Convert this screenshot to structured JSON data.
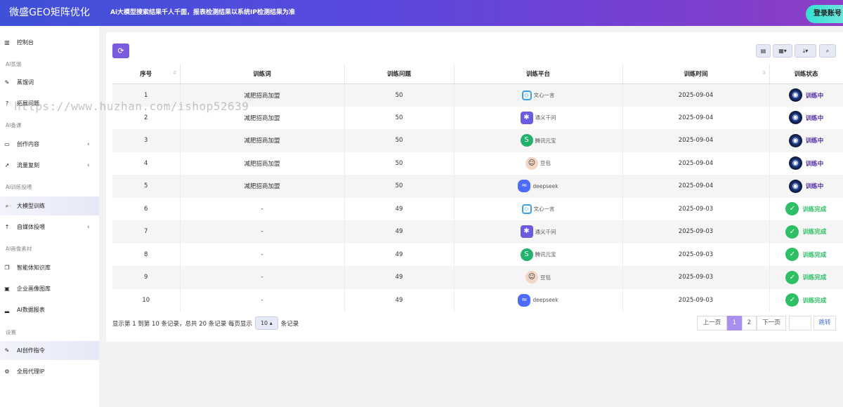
{
  "header": {
    "brand": "微盛GEO矩阵优化",
    "notice": "Ai大模型搜索结果千人千面，报表检测结果以系统IP检测结果为准",
    "login": "登录账号"
  },
  "sidebar": {
    "items": [
      {
        "label": "控制台",
        "icon": "chart-icon"
      },
      {
        "section": "AI蒸馏"
      },
      {
        "label": "蒸馏词",
        "icon": "tag-icon"
      },
      {
        "label": "拓展问题",
        "icon": "question-icon"
      },
      {
        "section": "AI备课"
      },
      {
        "label": "创作内容",
        "icon": "folder-icon",
        "arrow": "‹"
      },
      {
        "label": "流量复刻",
        "icon": "rocket-icon",
        "arrow": "‹"
      },
      {
        "section": "AI训练投喂"
      },
      {
        "label": "大模型训练",
        "icon": "search-icon"
      },
      {
        "label": "自媒体投喂",
        "icon": "arrow-up-icon",
        "arrow": "‹"
      },
      {
        "section": "AI画像素材"
      },
      {
        "label": "智能体知识库",
        "icon": "copy-icon"
      },
      {
        "label": "企业画像图库",
        "icon": "image-icon"
      },
      {
        "label": "AI数据报表",
        "icon": "bar-signal-icon"
      },
      {
        "section": "设置"
      },
      {
        "label": "AI创作指令",
        "icon": "tag-icon"
      },
      {
        "label": "全局代理IP",
        "icon": "gear-icon"
      }
    ]
  },
  "table": {
    "headers": [
      "序号",
      "训练词",
      "训练问题",
      "训练平台",
      "训练时间",
      "训练状态"
    ],
    "rows": [
      {
        "no": "1",
        "word": "减肥招商加盟",
        "questions": "50",
        "platform": "文心一言",
        "picon": "wenxin",
        "time": "2025-09-04",
        "status": "训练中",
        "st": "run"
      },
      {
        "no": "2",
        "word": "减肥招商加盟",
        "questions": "50",
        "platform": "通义千问",
        "picon": "tongyi",
        "time": "2025-09-04",
        "status": "训练中",
        "st": "run"
      },
      {
        "no": "3",
        "word": "减肥招商加盟",
        "questions": "50",
        "platform": "腾讯元宝",
        "picon": "tencent",
        "time": "2025-09-04",
        "status": "训练中",
        "st": "run"
      },
      {
        "no": "4",
        "word": "减肥招商加盟",
        "questions": "50",
        "platform": "豆包",
        "picon": "doubao",
        "time": "2025-09-04",
        "status": "训练中",
        "st": "run"
      },
      {
        "no": "5",
        "word": "减肥招商加盟",
        "questions": "50",
        "platform": "deepseek",
        "picon": "deepseek",
        "time": "2025-09-04",
        "status": "训练中",
        "st": "run"
      },
      {
        "no": "6",
        "word": "-",
        "questions": "49",
        "platform": "文心一言",
        "picon": "wenxin",
        "time": "2025-09-03",
        "status": "训练完成",
        "st": "done"
      },
      {
        "no": "7",
        "word": "-",
        "questions": "49",
        "platform": "通义千问",
        "picon": "tongyi",
        "time": "2025-09-03",
        "status": "训练完成",
        "st": "done"
      },
      {
        "no": "8",
        "word": "-",
        "questions": "49",
        "platform": "腾讯元宝",
        "picon": "tencent",
        "time": "2025-09-03",
        "status": "训练完成",
        "st": "done"
      },
      {
        "no": "9",
        "word": "-",
        "questions": "49",
        "platform": "豆包",
        "picon": "doubao",
        "time": "2025-09-03",
        "status": "训练完成",
        "st": "done"
      },
      {
        "no": "10",
        "word": "-",
        "questions": "49",
        "platform": "deepseek",
        "picon": "deepseek",
        "time": "2025-09-03",
        "status": "训练完成",
        "st": "done"
      }
    ]
  },
  "footer": {
    "summary_pre": "显示第 1 到第 10 条记录，总共 20 条记录 每页显示",
    "page_size": "10 ▴",
    "summary_post": "条记录",
    "prev": "上一页",
    "pages": [
      "1",
      "2"
    ],
    "next": "下一页",
    "jump": "跳转"
  },
  "watermark": "https://www.huzhan.com/ishop52639"
}
